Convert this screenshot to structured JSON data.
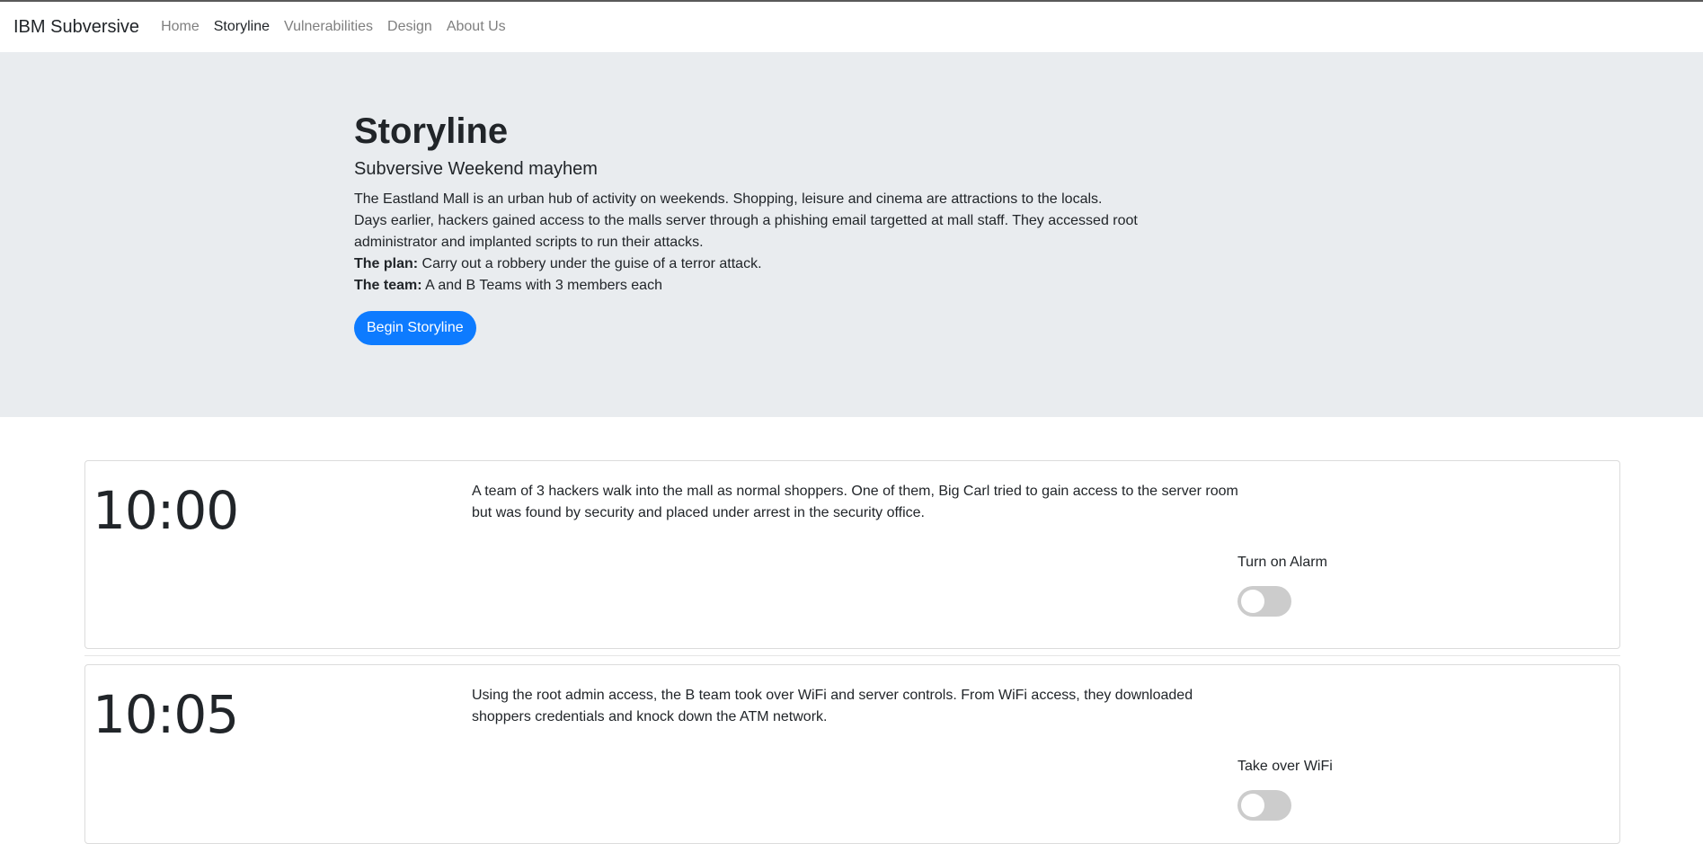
{
  "navbar": {
    "brand": "IBM Subversive",
    "items": [
      {
        "label": "Home",
        "active": false
      },
      {
        "label": "Storyline",
        "active": true
      },
      {
        "label": "Vulnerabilities",
        "active": false
      },
      {
        "label": "Design",
        "active": false
      },
      {
        "label": "About Us",
        "active": false
      }
    ]
  },
  "jumbotron": {
    "title": "Storyline",
    "subtitle": "Subversive Weekend mayhem",
    "para1": "The Eastland Mall is an urban hub of activity on weekends. Shopping, leisure and cinema are attractions to the locals.",
    "para2": "Days earlier, hackers gained access to the malls server through a phishing email targetted at mall staff. They accessed root administrator and implanted scripts to run their attacks.",
    "plan_label": "The plan:",
    "plan_text": " Carry out a robbery under the guise of a terror attack.",
    "team_label": "The team:",
    "team_text": " A and B Teams with 3 members each",
    "button": "Begin Storyline"
  },
  "events": [
    {
      "time": "10:00",
      "description": "A team of 3 hackers walk into the mall as normal shoppers. One of them, Big Carl tried to gain access to the server room but was found by security and placed under arrest in the security office.",
      "control_label": "Turn on Alarm",
      "toggle_on": false
    },
    {
      "time": "10:05",
      "description": "Using the root admin access, the B team took over WiFi and server controls. From WiFi access, they downloaded shoppers credentials and knock down the ATM network.",
      "control_label": "Take over WiFi",
      "toggle_on": false
    }
  ]
}
